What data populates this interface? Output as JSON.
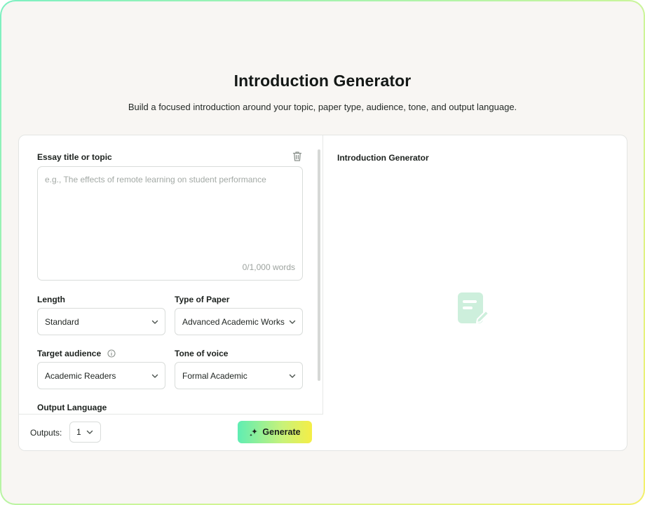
{
  "page": {
    "title": "Introduction Generator",
    "subtitle": "Build a focused introduction around your topic, paper type, audience, tone, and output language."
  },
  "form": {
    "topic": {
      "label": "Essay title or topic",
      "placeholder": "e.g., The effects of remote learning on student performance",
      "value": "",
      "word_count": "0/1,000 words",
      "clear_icon": "trash-icon"
    },
    "length": {
      "label": "Length",
      "value": "Standard"
    },
    "paper_type": {
      "label": "Type of Paper",
      "value": "Advanced Academic Works"
    },
    "audience": {
      "label": "Target audience",
      "value": "Academic Readers",
      "info_icon": "info-icon"
    },
    "tone": {
      "label": "Tone of voice",
      "value": "Formal Academic"
    },
    "output_language": {
      "label": "Output Language"
    }
  },
  "footer": {
    "outputs_label": "Outputs:",
    "outputs_value": "1",
    "generate_label": "Generate",
    "generate_icon": "sparkle-icon"
  },
  "result": {
    "title": "Introduction Generator",
    "empty_icon": "document-edit-icon"
  },
  "colors": {
    "accent_gradient_start": "#5fedb3",
    "accent_gradient_end": "#f5ee46",
    "empty_icon": "#c9eed9",
    "background": "#f8f6f3"
  }
}
